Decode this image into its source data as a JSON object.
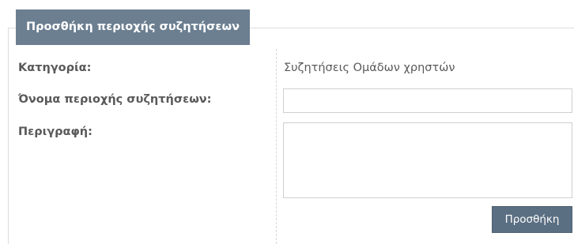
{
  "form": {
    "legend": "Προσθήκη περιοχής συζητήσεων",
    "category": {
      "label": "Κατηγορία:",
      "value": "Συζητήσεις Ομάδων χρηστών"
    },
    "name": {
      "label": "Όνομα περιοχής συζητήσεων:",
      "value": "",
      "placeholder": ""
    },
    "description": {
      "label": "Περιγραφή:",
      "value": "",
      "placeholder": ""
    },
    "submit_label": "Προσθήκη"
  },
  "colors": {
    "legend_bg": "#6c7f91",
    "button_bg": "#5b6f82",
    "label_text": "#595959"
  }
}
